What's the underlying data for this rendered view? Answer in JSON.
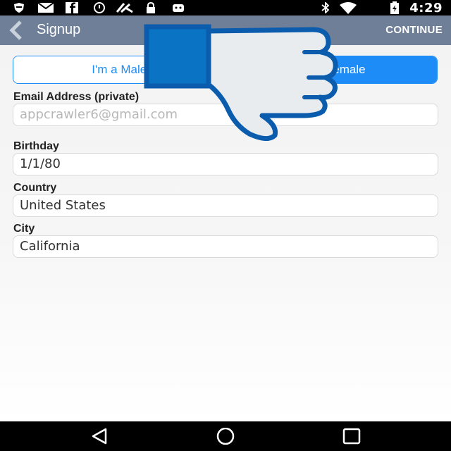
{
  "status_bar": {
    "time": "4:29",
    "icons": [
      "shield-icon",
      "mail-icon",
      "facebook-icon",
      "clock-icon",
      "appcrawler-icon",
      "lock-icon",
      "android-icon",
      "bluetooth-icon",
      "wifi-icon",
      "battery-icon"
    ]
  },
  "app_bar": {
    "title": "Signup",
    "continue_label": "CONTINUE",
    "background": "#6f7f98"
  },
  "gender": {
    "male_label": "I'm a Male",
    "female_label": "I'm a Female",
    "accent": "#1e8cf6"
  },
  "form": {
    "email_label": "Email Address (private)",
    "email_placeholder": "appcrawler6@gmail.com",
    "birthday_label": "Birthday",
    "birthday_value": "1/1/80",
    "country_label": "Country",
    "country_value": "United States",
    "city_label": "City",
    "city_value": "California"
  },
  "overlay": {
    "icon": "thumbs-down-icon",
    "fill": "#e8ecef",
    "stroke": "#0b5cad",
    "cuff": "#0a73c4"
  },
  "nav_bar": {
    "buttons": [
      "back-nav-icon",
      "home-nav-icon",
      "recents-nav-icon"
    ]
  }
}
